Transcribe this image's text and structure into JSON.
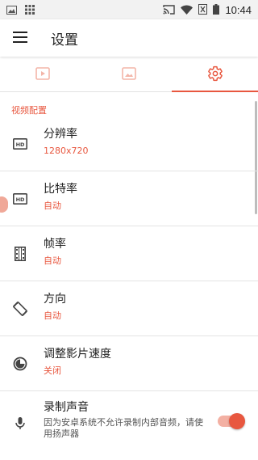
{
  "status_bar": {
    "time": "10:44",
    "icons": [
      "image-icon",
      "grid-icon",
      "cast-icon",
      "wifi-icon",
      "sim-icon",
      "battery-icon"
    ]
  },
  "app_bar": {
    "title": "设置",
    "menu_icon": "menu-icon"
  },
  "tabs": [
    {
      "icon": "video-icon",
      "active": false
    },
    {
      "icon": "image-icon",
      "active": false
    },
    {
      "icon": "gear-icon",
      "active": true
    }
  ],
  "section": {
    "title": "视频配置"
  },
  "settings": [
    {
      "icon": "hd-icon",
      "title": "分辨率",
      "value": "1280x720"
    },
    {
      "icon": "hd-icon",
      "title": "比特率",
      "value": "自动"
    },
    {
      "icon": "film-icon",
      "title": "帧率",
      "value": "自动"
    },
    {
      "icon": "rotate-icon",
      "title": "方向",
      "value": "自动"
    },
    {
      "icon": "speed-icon",
      "title": "调整影片速度",
      "value": "关闭"
    },
    {
      "icon": "mic-icon",
      "title": "录制声音",
      "description": "因为安卓系统不允许录制内部音频，请使用扬声器",
      "toggle": true
    }
  ],
  "colors": {
    "accent": "#e8573f",
    "icon_gray": "#444444",
    "inactive_tab": "#f3b5a8"
  }
}
